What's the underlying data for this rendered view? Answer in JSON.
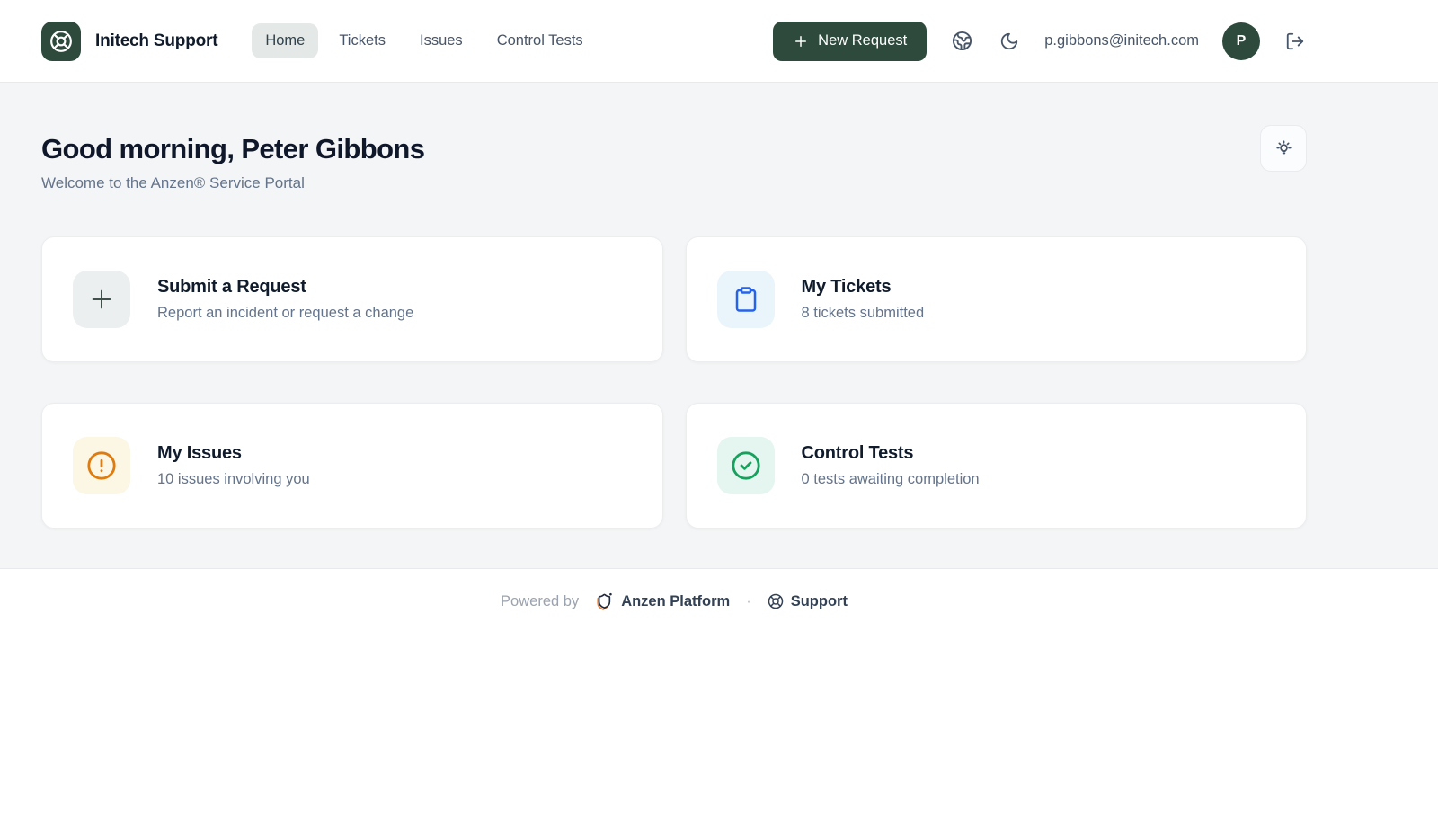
{
  "header": {
    "brand": "Initech Support",
    "nav": [
      {
        "label": "Home",
        "active": true
      },
      {
        "label": "Tickets",
        "active": false
      },
      {
        "label": "Issues",
        "active": false
      },
      {
        "label": "Control Tests",
        "active": false
      }
    ],
    "new_request_label": "New Request",
    "email": "p.gibbons@initech.com",
    "avatar_initial": "P"
  },
  "main": {
    "greeting": "Good morning, Peter Gibbons",
    "welcome": "Welcome to the Anzen® Service Portal",
    "cards": [
      {
        "title": "Submit a Request",
        "subtitle": "Report an incident or request a change",
        "icon": "plus-icon",
        "icon_bg": "#ECEFF0",
        "icon_color": "#41504A"
      },
      {
        "title": "My Tickets",
        "subtitle": "8 tickets submitted",
        "icon": "clipboard-icon",
        "icon_bg": "#E9F5FB",
        "icon_color": "#2563EB"
      },
      {
        "title": "My Issues",
        "subtitle": "10 issues involving you",
        "icon": "alert-circle-icon",
        "icon_bg": "#FCF6E4",
        "icon_color": "#DE7C0F"
      },
      {
        "title": "Control Tests",
        "subtitle": "0 tests awaiting completion",
        "icon": "check-circle-icon",
        "icon_bg": "#E5F5EF",
        "icon_color": "#17A15E"
      }
    ]
  },
  "footer": {
    "powered_by": "Powered by",
    "platform": "Anzen Platform",
    "separator": "·",
    "support": "Support"
  },
  "icons": {
    "logo": "lifebuoy-icon",
    "language": "globe-icon",
    "theme": "moon-icon",
    "sign_out": "log-out-icon",
    "tip": "lightbulb-icon",
    "platform": "shield-icon",
    "support": "lifebuoy-icon"
  },
  "colors": {
    "accent_green": "#2D4A3C",
    "page_bg": "#F4F5F6",
    "text_primary": "#0F172A",
    "text_secondary": "#64748B",
    "nav_active_bg": "#E4E8E6",
    "blue": "#2563EB",
    "orange": "#DE7C0F",
    "green": "#17A15E"
  }
}
